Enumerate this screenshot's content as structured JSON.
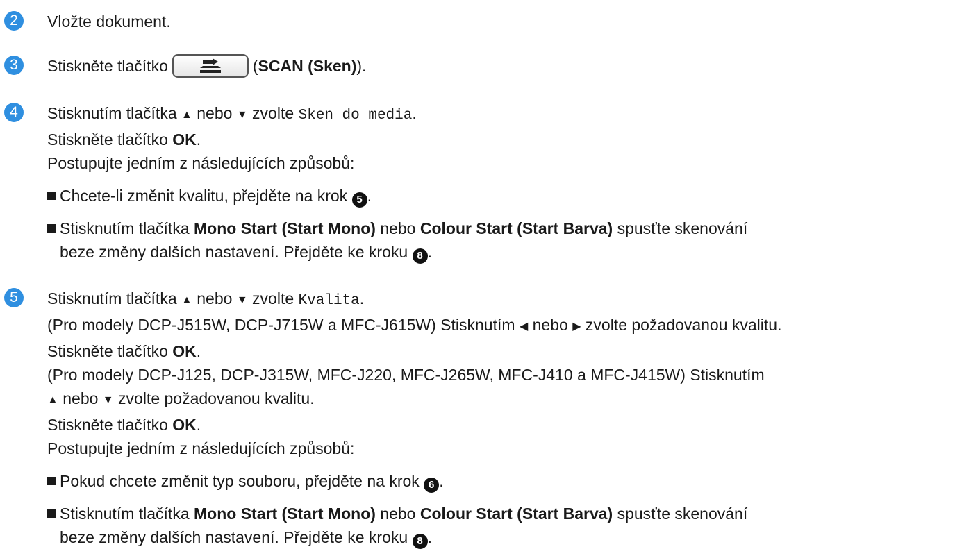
{
  "colors": {
    "step_badge": "#2f8fe0"
  },
  "steps": [
    {
      "num": "2",
      "text": "Vložte dokument."
    },
    {
      "num": "3",
      "pre": "Stiskněte tlačítko",
      "button_icon": "scan-icon",
      "open": "(",
      "bold": "SCAN (Sken)",
      "close": ")."
    },
    {
      "num": "4",
      "l1_pre": "Stisknutím tlačítka",
      "up": "▲",
      "mid": "nebo",
      "down": "▼",
      "l1_post": "zvolte",
      "l1_mono": "Sken do media",
      "l1_end": ".",
      "l2_pre": "Stiskněte tlačítko",
      "l2_bold": "OK",
      "l2_end": ".",
      "l3": "Postupujte jedním z následujících způsobů:",
      "b1_pre": "Chcete-li změnit kvalitu, přejděte na krok",
      "b1_ref": "5",
      "b1_end": ".",
      "b2_pre": "Stisknutím tlačítka",
      "b2_bold1": "Mono Start (Start Mono)",
      "b2_mid": "nebo",
      "b2_bold2": "Colour Start (Start Barva)",
      "b2_post": "spusťte skenování",
      "b2_l2": "beze změny dalších nastavení. Přejděte ke kroku",
      "b2_ref": "8",
      "b2_end": "."
    },
    {
      "num": "5",
      "l1_pre": "Stisknutím tlačítka",
      "up": "▲",
      "mid": "nebo",
      "down": "▼",
      "l1_post": "zvolte",
      "l1_mono": "Kvalita",
      "l1_end": ".",
      "l2_pre": "(Pro modely DCP-J515W, DCP-J715W a MFC-J615W) Stisknutím",
      "left": "◀",
      "l2_mid": "nebo",
      "right": "▶",
      "l2_post": "zvolte požadovanou kvalitu.",
      "l3_pre": "Stiskněte tlačítko",
      "l3_bold": "OK",
      "l3_end": ".",
      "l4": "(Pro modely DCP-J125, DCP-J315W, MFC-J220, MFC-J265W, MFC-J410 a MFC-J415W) Stisknutím",
      "l5_up": "▲",
      "l5_mid": "nebo",
      "l5_down": "▼",
      "l5_post": "zvolte požadovanou kvalitu.",
      "l6_pre": "Stiskněte tlačítko",
      "l6_bold": "OK",
      "l6_end": ".",
      "l7": "Postupujte jedním z následujících způsobů:",
      "b1_pre": "Pokud chcete změnit typ souboru, přejděte na krok",
      "b1_ref": "6",
      "b1_end": ".",
      "b2_pre": "Stisknutím tlačítka",
      "b2_bold1": "Mono Start (Start Mono)",
      "b2_mid": "nebo",
      "b2_bold2": "Colour Start (Start Barva)",
      "b2_post": "spusťte skenování",
      "b2_l2": "beze změny dalších nastavení. Přejděte ke kroku",
      "b2_ref": "8",
      "b2_end": "."
    }
  ]
}
